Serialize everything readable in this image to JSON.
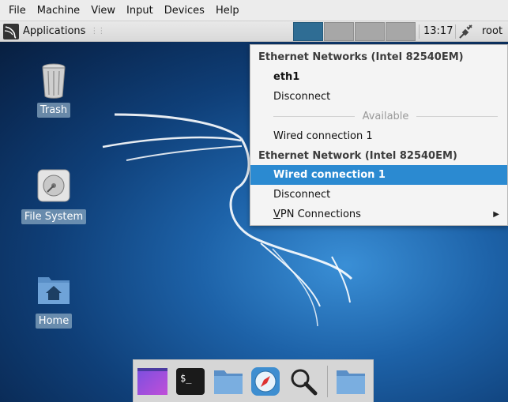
{
  "vm_menu": [
    "File",
    "Machine",
    "View",
    "Input",
    "Devices",
    "Help"
  ],
  "panel": {
    "applications_label": "Applications",
    "workspaces": 4,
    "active_workspace": 1,
    "clock": "13:17",
    "user": "root"
  },
  "desktop_icons": {
    "trash": "Trash",
    "filesystem": "File System",
    "home": "Home"
  },
  "network_menu": {
    "header1": "Ethernet Networks (Intel 82540EM)",
    "eth1": "eth1",
    "disconnect1": "Disconnect",
    "available": "Available",
    "wired1": "Wired connection 1",
    "header2": "Ethernet Network (Intel 82540EM)",
    "wired_selected": "Wired connection 1",
    "disconnect2": "Disconnect",
    "vpn_prefix": "V",
    "vpn_rest": "PN Connections"
  },
  "colors": {
    "selection": "#2b8ad1",
    "active_workspace": "#2f6d94"
  },
  "dock_icons": [
    "desktop-preview-icon",
    "terminal-icon",
    "folder-icon",
    "web-browser-icon",
    "search-icon",
    "folder-icon"
  ]
}
